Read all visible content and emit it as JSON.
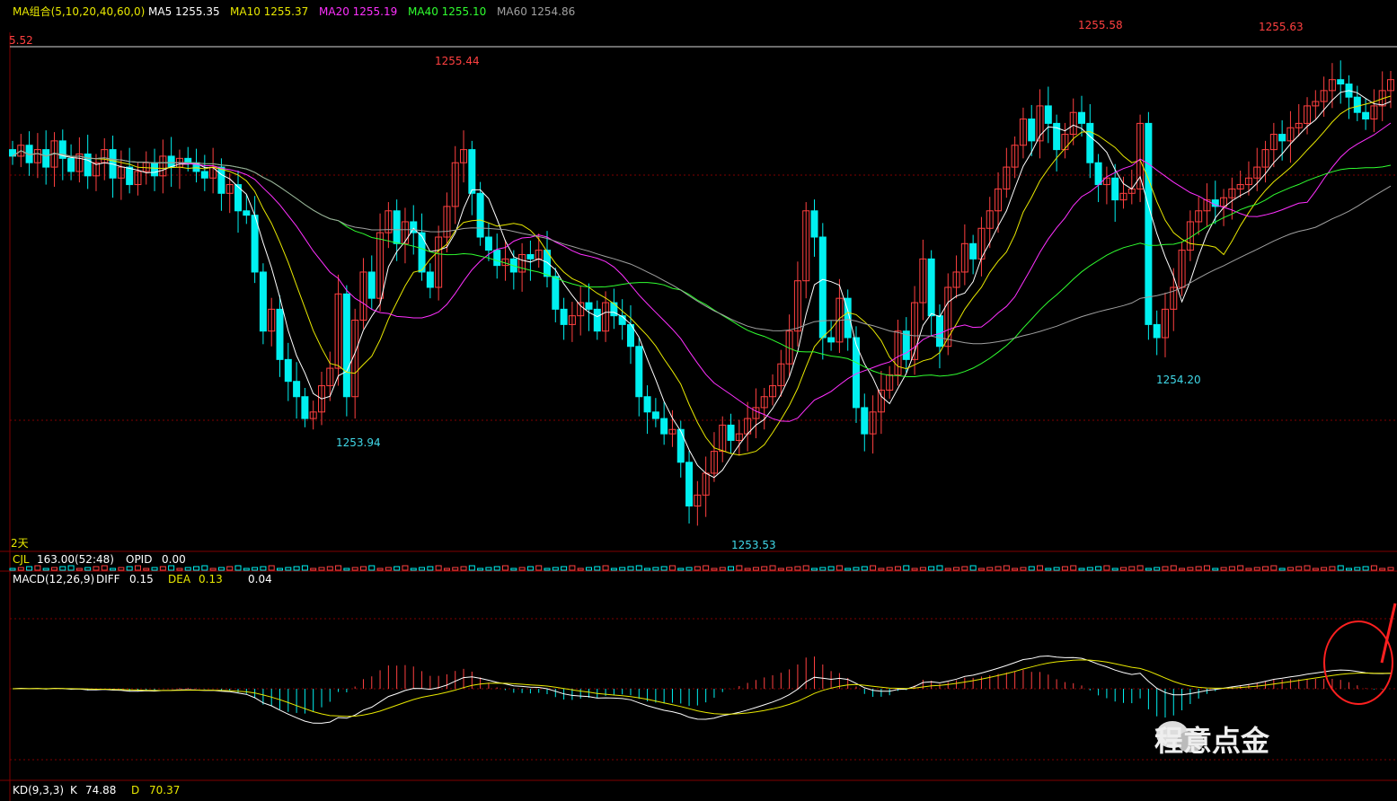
{
  "colors": {
    "up": "#ff4040",
    "down": "#00f0f0",
    "ma5": "#ffffff",
    "ma10": "#e8e800",
    "ma20": "#ff30ff",
    "ma40": "#30ff30",
    "ma60": "#a0a0a0",
    "grid": "#800000",
    "annot_hi": "#ff4040",
    "annot_lo": "#40d8e8"
  },
  "header": {
    "ma_group": "MA组合(5,10,20,40,60,0)",
    "ma5": "MA5 1255.35",
    "ma10": "MA10 1255.37",
    "ma20": "MA20 1255.19",
    "ma40": "MA40 1255.10",
    "ma60": "MA60 1254.86"
  },
  "price_axis_label_top": "5.52",
  "period_label": "2天",
  "vol_header": {
    "name": "CJL",
    "value": "163.00(52:48)",
    "opid_label": "OPID",
    "opid_value": "0.00"
  },
  "macd_header": {
    "name": "MACD(12,26,9)",
    "diff_label": "DIFF",
    "diff": "0.15",
    "dea_label": "DEA",
    "dea": "0.13",
    "macd": "0.04"
  },
  "kd_header": {
    "name": "KD(9,3,3)",
    "k_label": "K",
    "k": "74.88",
    "d_label": "D",
    "d": "70.37"
  },
  "watermark": "程意点金",
  "chart_data": {
    "type": "candlestick",
    "price_ylim": [
      1253.4,
      1255.7
    ],
    "price_ref_line": 1255.52,
    "series_note": "MA lines computed from closes",
    "annotations": [
      {
        "label": "1255.44",
        "kind": "high"
      },
      {
        "label": "1253.94",
        "kind": "low"
      },
      {
        "label": "1253.53",
        "kind": "low"
      },
      {
        "label": "1255.58",
        "kind": "high"
      },
      {
        "label": "1254.20",
        "kind": "low"
      },
      {
        "label": "1255.63",
        "kind": "high"
      }
    ],
    "closes": [
      1255.15,
      1255.2,
      1255.12,
      1255.18,
      1255.1,
      1255.22,
      1255.14,
      1255.08,
      1255.16,
      1255.06,
      1255.12,
      1255.18,
      1255.05,
      1255.1,
      1255.02,
      1255.08,
      1255.12,
      1255.06,
      1255.15,
      1255.1,
      1255.14,
      1255.12,
      1255.08,
      1255.05,
      1255.1,
      1254.98,
      1255.02,
      1254.9,
      1254.88,
      1254.62,
      1254.35,
      1254.45,
      1254.22,
      1254.12,
      1254.05,
      1253.95,
      1253.98,
      1254.1,
      1254.18,
      1254.52,
      1254.05,
      1254.4,
      1254.62,
      1254.5,
      1254.8,
      1254.9,
      1254.75,
      1254.85,
      1254.8,
      1254.62,
      1254.55,
      1254.78,
      1254.92,
      1255.12,
      1255.18,
      1254.98,
      1254.78,
      1254.72,
      1254.65,
      1254.68,
      1254.62,
      1254.7,
      1254.68,
      1254.72,
      1254.6,
      1254.45,
      1254.38,
      1254.42,
      1254.48,
      1254.45,
      1254.35,
      1254.48,
      1254.42,
      1254.38,
      1254.28,
      1254.05,
      1253.98,
      1253.95,
      1253.88,
      1253.9,
      1253.75,
      1253.55,
      1253.6,
      1253.7,
      1253.8,
      1253.92,
      1253.85,
      1253.88,
      1253.95,
      1254.0,
      1254.05,
      1254.1,
      1254.2,
      1254.35,
      1254.58,
      1254.9,
      1254.78,
      1254.32,
      1254.3,
      1254.5,
      1254.32,
      1254.0,
      1253.88,
      1253.98,
      1254.08,
      1254.15,
      1254.35,
      1254.22,
      1254.48,
      1254.68,
      1254.42,
      1254.28,
      1254.55,
      1254.62,
      1254.75,
      1254.68,
      1254.82,
      1254.9,
      1255.0,
      1255.1,
      1255.2,
      1255.32,
      1255.22,
      1255.38,
      1255.3,
      1255.18,
      1255.25,
      1255.35,
      1255.3,
      1255.12,
      1255.02,
      1255.05,
      1254.95,
      1254.98,
      1255.0,
      1255.3,
      1254.38,
      1254.32,
      1254.45,
      1254.55,
      1254.72,
      1254.85,
      1254.9,
      1254.95,
      1254.92,
      1254.96,
      1255.0,
      1255.02,
      1255.05,
      1255.1,
      1255.18,
      1255.25,
      1255.22,
      1255.28,
      1255.3,
      1255.38,
      1255.4,
      1255.45,
      1255.5,
      1255.48,
      1255.42,
      1255.35,
      1255.32,
      1255.38,
      1255.45,
      1255.5
    ],
    "macd_ylim": [
      -0.6,
      0.6
    ],
    "kd_values": {
      "K": 74.88,
      "D": 70.37
    }
  }
}
